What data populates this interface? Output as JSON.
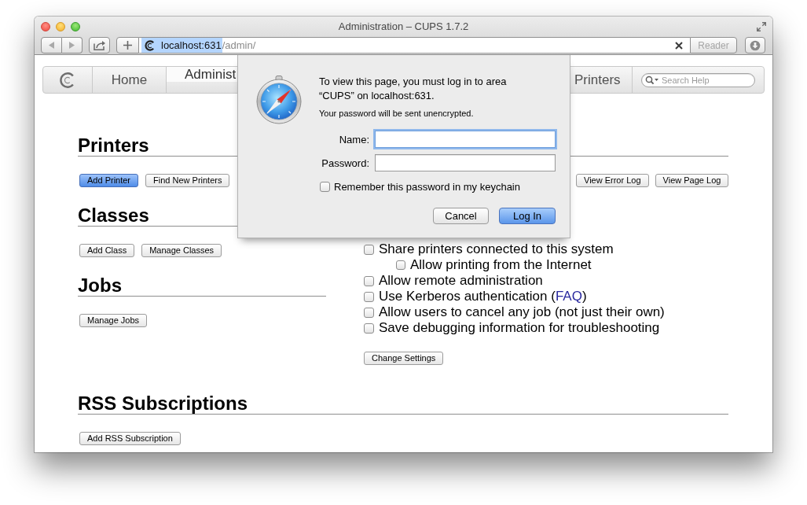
{
  "window": {
    "title": "Administration – CUPS 1.7.2"
  },
  "address_bar": {
    "host": "localhost:631",
    "host_selected": true,
    "path": "/admin/",
    "reader_button": {
      "label": "Reader",
      "disabled": true
    }
  },
  "nav": {
    "tabs": [
      {
        "label": "Home",
        "selected": false
      },
      {
        "label": "Administ",
        "selected": true
      },
      {
        "label": "Printers",
        "selected": false
      }
    ],
    "search": {
      "placeholder": "Search Help"
    }
  },
  "left_sections": [
    {
      "title": "Printers",
      "buttons": [
        {
          "label": "Add Printer",
          "default": true
        },
        {
          "label": "Find New Printers",
          "default": false
        }
      ]
    },
    {
      "title": "Classes",
      "buttons": [
        {
          "label": "Add Class",
          "default": false
        },
        {
          "label": "Manage Classes",
          "default": false
        }
      ]
    },
    {
      "title": "Jobs",
      "buttons": [
        {
          "label": "Manage Jobs",
          "default": false
        }
      ]
    }
  ],
  "server_section": {
    "buttons": [
      {
        "label": "View Error Log",
        "default": false
      },
      {
        "label": "View Page Log",
        "default": false
      }
    ],
    "settings": [
      {
        "label": "Share printers connected to this system",
        "checked": false,
        "children": [
          {
            "label": "Allow printing from the Internet",
            "checked": false
          }
        ]
      },
      {
        "label": "Allow remote administration",
        "checked": false
      },
      {
        "label": "Use Kerberos authentication (",
        "link": "FAQ",
        "label_end": ")",
        "checked": false
      },
      {
        "label": "Allow users to cancel any job (not just their own)",
        "checked": false
      },
      {
        "label": "Save debugging information for troubleshooting",
        "checked": false
      }
    ],
    "submit_button": {
      "label": "Change Settings",
      "default": false
    }
  },
  "rss_section": {
    "title": "RSS Subscriptions",
    "buttons": [
      {
        "label": "Add RSS Subscription",
        "default": false
      }
    ]
  },
  "login_dialog": {
    "message": "To view this page, you must log in to area “CUPS” on localhost:631.",
    "note": "Your password will be sent unencrypted.",
    "fields": [
      {
        "label": "Name:",
        "focused": true
      },
      {
        "label": "Password:",
        "focused": false
      }
    ],
    "remember": {
      "label": "Remember this password in my keychain",
      "checked": false
    },
    "buttons": [
      {
        "label": "Cancel",
        "default": false
      },
      {
        "label": "Log In",
        "default": true
      }
    ]
  }
}
